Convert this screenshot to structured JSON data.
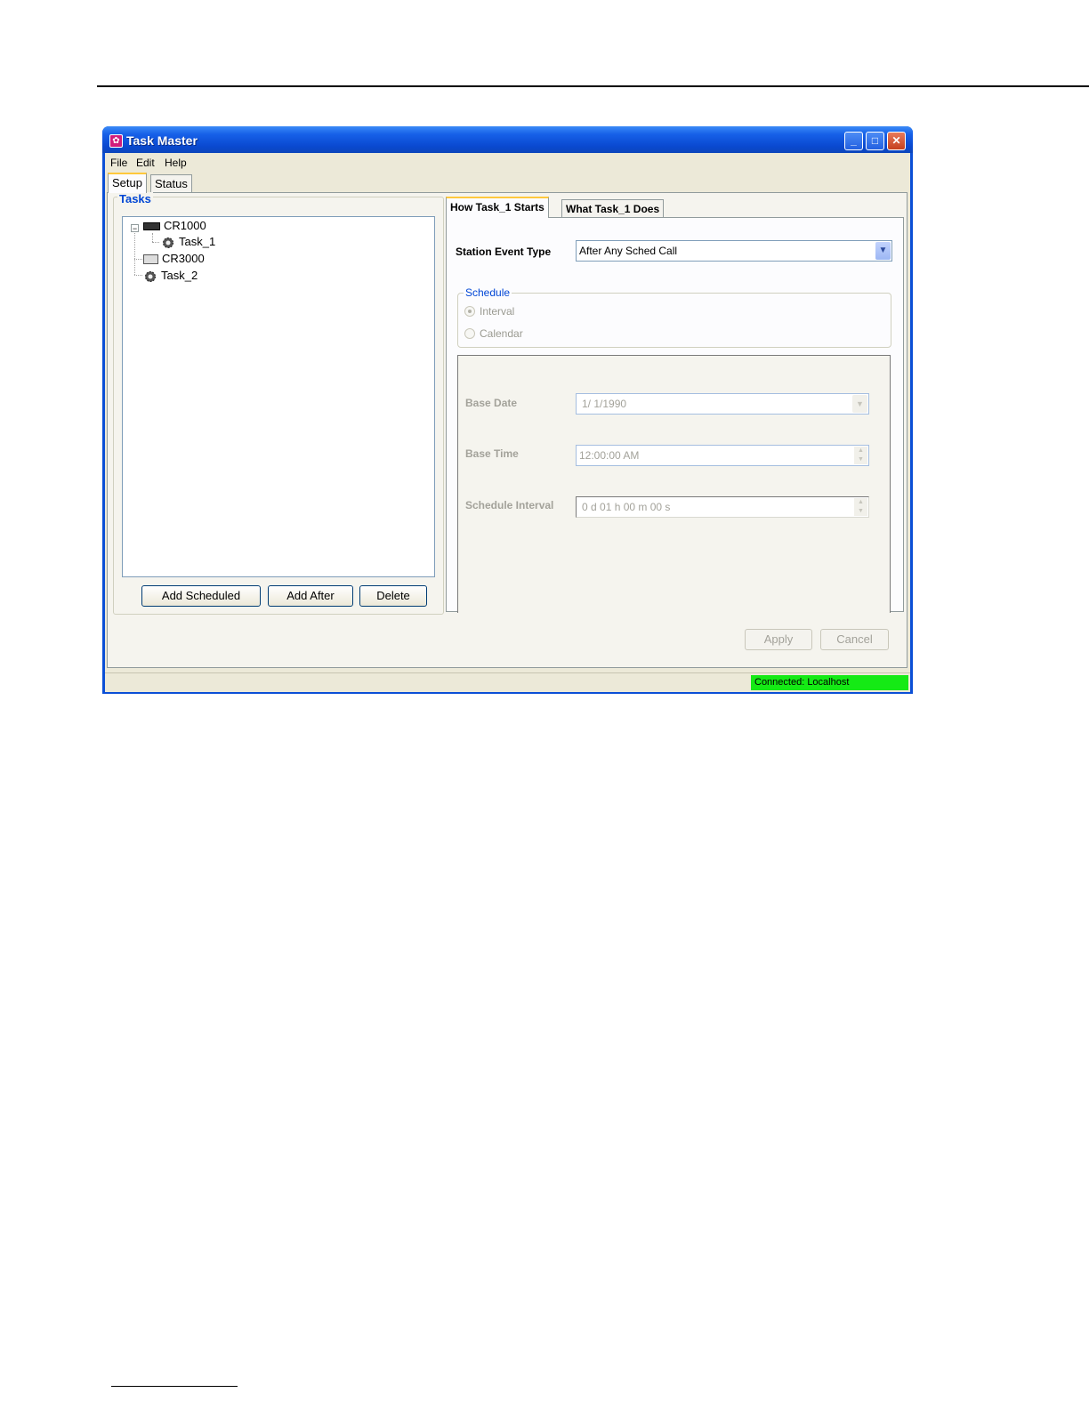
{
  "window": {
    "title": "Task Master"
  },
  "menu": [
    "File",
    "Edit",
    "Help"
  ],
  "main_tabs": [
    "Setup",
    "Status"
  ],
  "tasks": {
    "legend": "Tasks",
    "tree": [
      {
        "label": "CR1000",
        "icon": "datalogger-icon"
      },
      {
        "label": "Task_1",
        "icon": "gear-icon"
      },
      {
        "label": "CR3000",
        "icon": "datalogger-icon"
      },
      {
        "label": "Task_2",
        "icon": "gear-icon"
      }
    ],
    "buttons": {
      "add_scheduled": "Add Scheduled",
      "add_after": "Add After",
      "delete": "Delete"
    }
  },
  "detail_tabs": [
    "How Task_1 Starts",
    "What Task_1 Does"
  ],
  "starts": {
    "station_event_label": "Station Event Type",
    "station_event_value": "After Any Sched Call",
    "schedule_legend": "Schedule",
    "radio_interval": "Interval",
    "radio_calendar": "Calendar",
    "base_date_label": "Base Date",
    "base_date_value": "1/  1/1990",
    "base_time_label": "Base Time",
    "base_time_value": "12:00:00 AM",
    "interval_label": "Schedule Interval",
    "interval_value": "0 d 01 h 00 m 00 s"
  },
  "actions": {
    "apply": "Apply",
    "cancel": "Cancel"
  },
  "status": {
    "connection": "Connected: Localhost",
    "connection_color": "#15ea15"
  }
}
